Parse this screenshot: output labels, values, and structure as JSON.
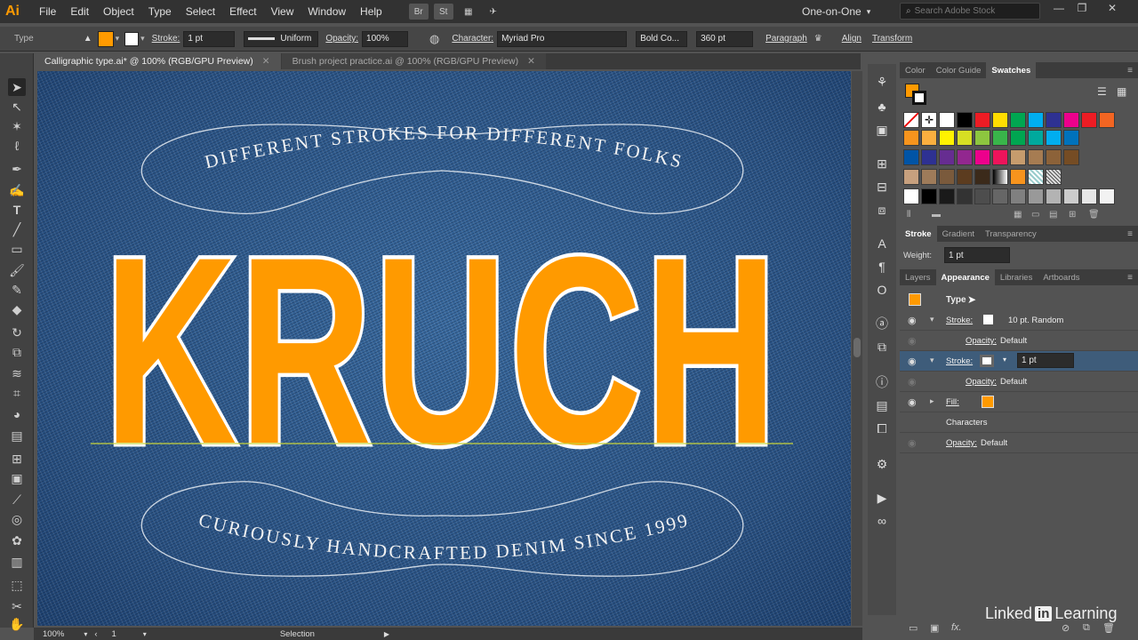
{
  "app": {
    "logo": "Ai"
  },
  "menu": [
    "File",
    "Edit",
    "Object",
    "Type",
    "Select",
    "Effect",
    "View",
    "Window",
    "Help"
  ],
  "menubar_icons": {
    "bridge": "Br",
    "stock": "St",
    "arrange": "▦",
    "gpu": "✈"
  },
  "workspace": "One-on-One",
  "search_placeholder": "Search Adobe Stock",
  "window_controls": {
    "minimize": "—",
    "restore": "❐",
    "close": "✕"
  },
  "control": {
    "type_label": "Type",
    "fill_color": "#ff9a00",
    "stroke_label": "Stroke:",
    "stroke_weight": "1 pt",
    "stroke_profile": "Uniform",
    "opacity_label": "Opacity:",
    "opacity_value": "100%",
    "character_label": "Character:",
    "font_family": "Myriad Pro",
    "font_style": "Bold Co...",
    "font_size": "360 pt",
    "paragraph_label": "Paragraph",
    "align_label": "Align",
    "transform_label": "Transform"
  },
  "tabs": [
    {
      "title": "Calligraphic type.ai* @ 100% (RGB/GPU Preview)",
      "active": true
    },
    {
      "title": "Brush project practice.ai @ 100% (RGB/GPU Preview)",
      "active": false
    }
  ],
  "artwork": {
    "top_tagline": "DIFFERENT STROKES FOR DIFFERENT FOLKS",
    "headline": "KRUCH",
    "bottom_tagline": "CURIOUSLY HANDCRAFTED DENIM SINCE 1999",
    "headline_color": "#ff9a00"
  },
  "status": {
    "zoom": "100%",
    "artboard": "1",
    "mode": "Selection"
  },
  "swatches_tabs": [
    "Color",
    "Color Guide",
    "Swatches"
  ],
  "swatch_colors": [
    [
      "none",
      "reg",
      "#ffffff",
      "#000000",
      "#ed1c24",
      "#ffdd00",
      "#00a651",
      "#00aeef",
      "#2e3192",
      "#ec008c",
      "#ed1c24",
      "#f26522"
    ],
    [
      "#f7941d",
      "#fbaf3f",
      "#fff200",
      "#d7df23",
      "#8dc63f",
      "#39b54a",
      "#00a651",
      "#00a99d",
      "#00aeef",
      "#0072bc"
    ],
    [
      "#0054a6",
      "#2e3192",
      "#662d91",
      "#92278f",
      "#ec008c",
      "#ed145b",
      "#c69c6d",
      "#a67c52",
      "#8c6239",
      "#754c24"
    ],
    [
      "#c7a07e",
      "#9e7b5a",
      "#7a5a3c",
      "#5c3c1f",
      "#3b2a1a",
      "grad",
      "#f7941d",
      "pattern",
      "pattern2"
    ],
    [
      "#ffffff",
      "#000000",
      "#1a1a1a",
      "#333333",
      "#4d4d4d",
      "#666666",
      "#808080",
      "#999999",
      "#b3b3b3",
      "#cccccc",
      "#e6e6e6",
      "#f2f2f2"
    ]
  ],
  "stroke_tabs": [
    "Stroke",
    "Gradient",
    "Transparency"
  ],
  "stroke_weight_label": "Weight:",
  "stroke_weight_value": "1 pt",
  "appearance_tabs": [
    "Layers",
    "Appearance",
    "Libraries",
    "Artboards"
  ],
  "appearance": {
    "title": "Type",
    "swatch": "#ff9a00",
    "rows": [
      {
        "kind": "stroke",
        "label": "Stroke:",
        "value": "10 pt. Random",
        "highlight": false
      },
      {
        "kind": "opacity",
        "label": "Opacity:",
        "value": "Default"
      },
      {
        "kind": "stroke",
        "label": "Stroke:",
        "value": "1 pt",
        "highlight": true
      },
      {
        "kind": "opacity",
        "label": "Opacity:",
        "value": "Default"
      },
      {
        "kind": "fill",
        "label": "Fill:",
        "value": ""
      },
      {
        "kind": "characters",
        "label": "Characters",
        "value": ""
      },
      {
        "kind": "opacity",
        "label": "Opacity:",
        "value": "Default"
      }
    ]
  },
  "watermark": {
    "left": "Linked",
    "box": "in",
    "right": "Learning"
  }
}
